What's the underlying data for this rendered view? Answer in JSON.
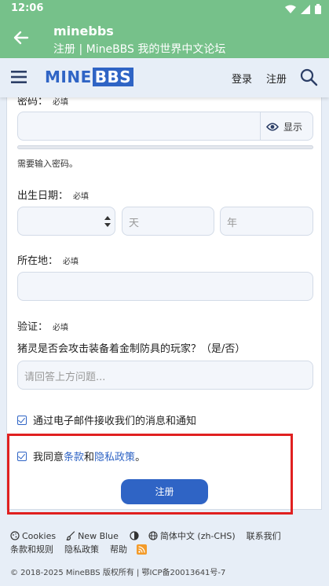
{
  "status_bar": {
    "time": "12:06"
  },
  "app_bar": {
    "title": "minebbs",
    "subtitle": "注册 | MineBBS 我的世界中文论坛"
  },
  "site_nav": {
    "logo_left": "MINE",
    "logo_right": "BBS",
    "login": "登录",
    "register": "注册"
  },
  "form": {
    "password_label": "密码：",
    "password_required": "必填",
    "password_show": "显示",
    "password_hint": "需要输入密码。",
    "birthday_label": "出生日期：",
    "birthday_required": "必填",
    "day_placeholder": "天",
    "year_placeholder": "年",
    "location_label": "所在地：",
    "location_required": "必填",
    "verify_label": "验证：",
    "verify_required": "必填",
    "verify_question": "猪灵是否会攻击装备着金制防具的玩家？（是/否）",
    "answer_placeholder": "请回答上方问题...",
    "email_opt_in": "通过电子邮件接收我们的消息和通知",
    "agree_prefix": "我同意",
    "terms_link": "条款",
    "agree_and": "和",
    "privacy_link": "隐私政策",
    "agree_suffix": "。",
    "submit": "注册"
  },
  "footer": {
    "cookies": "Cookies",
    "style": "New Blue",
    "language": "简体中文 (zh-CHS)",
    "contact": "联系我们",
    "terms": "条款和规则",
    "privacy": "隐私政策",
    "help": "帮助",
    "copyright": "© 2018-2025 MineBBS 版权所有 | 鄂ICP备20013641号-7"
  },
  "colors": {
    "app_bar": "#76c18a",
    "accent": "#2f64c5",
    "highlight": "#e02020"
  }
}
